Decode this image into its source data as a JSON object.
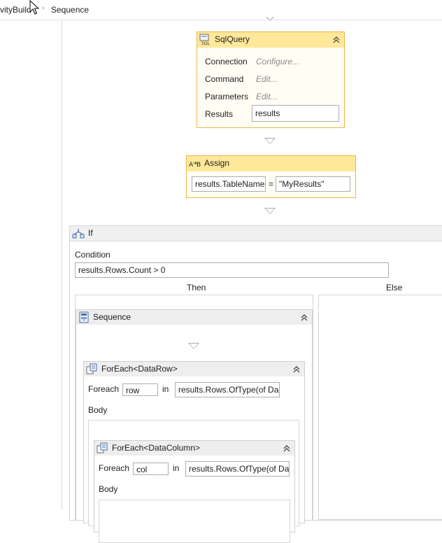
{
  "breadcrumb": {
    "items": [
      "vityBuild",
      "Sequence"
    ]
  },
  "sql_query": {
    "title": "SqlQuery",
    "icon": "sql-icon",
    "connection_label": "Connection",
    "connection_value": "Configure...",
    "command_label": "Command",
    "command_value": "Edit...",
    "parameters_label": "Parameters",
    "parameters_value": "Edit...",
    "results_label": "Results",
    "results_value": "results"
  },
  "assign": {
    "title": "Assign",
    "icon": "assign-icon",
    "to_value": "results.TableName",
    "operator": "=",
    "value": "\"MyResults\""
  },
  "if_activity": {
    "title": "If",
    "condition_label": "Condition",
    "condition_value": "results.Rows.Count > 0",
    "then_label": "Then",
    "else_label": "Else"
  },
  "sequence": {
    "title": "Sequence"
  },
  "foreach_row": {
    "title": "ForEach<DataRow>",
    "foreach_label": "Foreach",
    "var_value": "row",
    "in_label": "in",
    "values_value": "results.Rows.OfType(of Da",
    "body_label": "Body"
  },
  "foreach_col": {
    "title": "ForEach<DataColumn>",
    "foreach_label": "Foreach",
    "var_value": "col",
    "in_label": "in",
    "values_value": "results.Rows.OfType(of Da",
    "body_label": "Body"
  },
  "colors": {
    "activity_header": "#ffe89a",
    "activity_border": "#e8b84a",
    "container_header": "#eeeeee"
  }
}
